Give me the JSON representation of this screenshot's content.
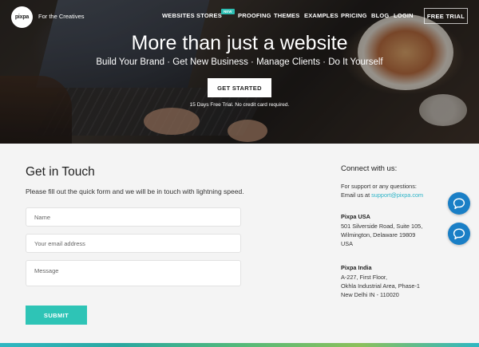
{
  "brand": {
    "logo_text": "pixpa",
    "tagline": "For the Creatives"
  },
  "nav": {
    "items": [
      "WEBSITES",
      "STORES",
      "PROOFING",
      "THEMES",
      "EXAMPLES",
      "PRICING",
      "BLOG",
      "LOGIN"
    ],
    "stores_badge": "NEW",
    "trial_button": "FREE TRIAL"
  },
  "hero": {
    "headline": "More than just a website",
    "subhead": "Build Your Brand  · Get New Business  · Manage Clients  · Do It Yourself",
    "cta_label": "GET STARTED",
    "note": "15 Days Free Trial. No credit card required."
  },
  "form": {
    "title": "Get in Touch",
    "description": "Please fill out the quick form and we will be in touch with lightning speed.",
    "name_placeholder": "Name",
    "email_placeholder": "Your email address",
    "message_placeholder": "Message",
    "submit_label": "SUBMIT"
  },
  "connect": {
    "title": "Connect with us:",
    "support_line": "For support or any questions:",
    "email_prefix": "Email us at ",
    "email": "support@pixpa.com",
    "usa": {
      "name": "Pixpa USA",
      "line1": "501 Silverside Road, Suite 105,",
      "line2": "Wilmington, Delaware 19809",
      "line3": "USA"
    },
    "india": {
      "name": "Pixpa India",
      "line1": "A-227, First Floor,",
      "line2": "Okhla Industrial Area, Phase-1",
      "line3": "New Delhi IN - 110020"
    }
  },
  "colors": {
    "accent": "#2ec4b6",
    "chat_button": "#1a7fc6",
    "link": "#2ab3c7"
  },
  "icons": {
    "chat": "chat-bubble-icon"
  }
}
